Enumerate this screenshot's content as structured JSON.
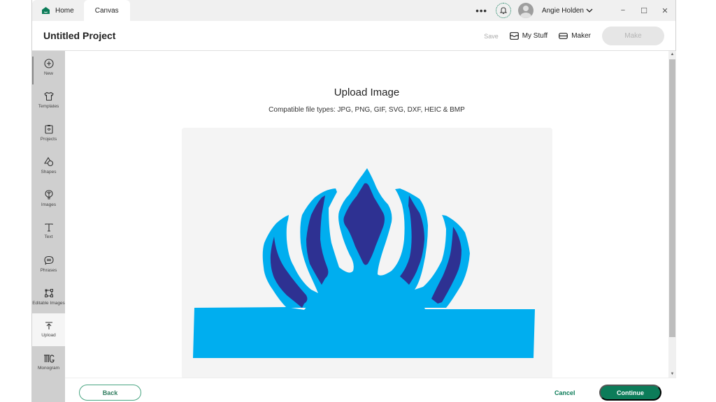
{
  "titlebar": {
    "tabs": [
      {
        "label": "Home",
        "icon": "home-icon"
      },
      {
        "label": "Canvas"
      }
    ],
    "more_icon": "more-dots-icon",
    "notification_icon": "bell-icon",
    "user_name": "Angie Holden",
    "window_controls": {
      "minimize": "−",
      "maximize": "☐",
      "close": "✕"
    }
  },
  "header": {
    "project_title": "Untitled Project",
    "save_label": "Save",
    "my_stuff_label": "My Stuff",
    "maker_label": "Maker",
    "make_label": "Make"
  },
  "sidebar": {
    "items": [
      {
        "label": "New",
        "icon": "plus-circle-icon"
      },
      {
        "label": "Templates",
        "icon": "tshirt-icon"
      },
      {
        "label": "Projects",
        "icon": "clipboard-icon"
      },
      {
        "label": "Shapes",
        "icon": "shapes-icon"
      },
      {
        "label": "Images",
        "icon": "lightbulb-icon"
      },
      {
        "label": "Text",
        "icon": "text-icon"
      },
      {
        "label": "Phrases",
        "icon": "speech-bubble-icon"
      },
      {
        "label": "Editable Images",
        "icon": "edit-image-icon"
      },
      {
        "label": "Upload",
        "icon": "upload-icon",
        "active": true
      },
      {
        "label": "Monogram",
        "icon": "monogram-icon"
      }
    ]
  },
  "upload": {
    "title": "Upload Image",
    "subtitle": "Compatible file types:  JPG, PNG, GIF, SVG, DXF, HEIC & BMP",
    "preview_colors": {
      "outer": "#00aeef",
      "inner": "#2e3192",
      "background": "#f4f4f4"
    }
  },
  "footer": {
    "back_label": "Back",
    "cancel_label": "Cancel",
    "continue_label": "Continue"
  },
  "colors": {
    "accent": "#0c7c59"
  }
}
